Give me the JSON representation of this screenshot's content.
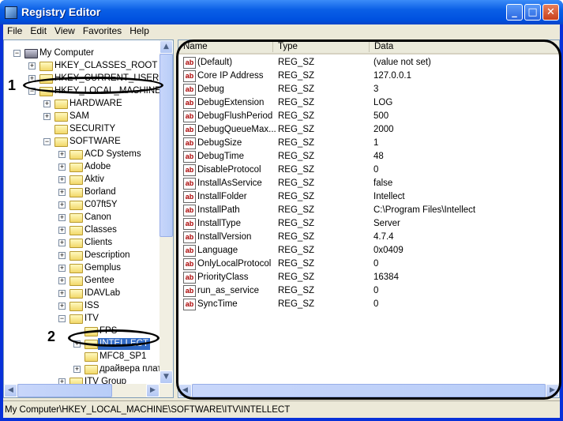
{
  "window": {
    "title": "Registry Editor",
    "min": "_",
    "max": "□",
    "close": "✕"
  },
  "menu": [
    "File",
    "Edit",
    "View",
    "Favorites",
    "Help"
  ],
  "tree": [
    {
      "label": "My Computer",
      "level": 0,
      "exp": "−",
      "icon": "computer"
    },
    {
      "label": "HKEY_CLASSES_ROOT",
      "level": 1,
      "exp": "+"
    },
    {
      "label": "HKEY_CURRENT_USER",
      "level": 1,
      "exp": "+"
    },
    {
      "label": "HKEY_LOCAL_MACHINE",
      "level": 1,
      "exp": "−"
    },
    {
      "label": "HARDWARE",
      "level": 2,
      "exp": "+"
    },
    {
      "label": "SAM",
      "level": 2,
      "exp": "+"
    },
    {
      "label": "SECURITY",
      "level": 2,
      "exp": ""
    },
    {
      "label": "SOFTWARE",
      "level": 2,
      "exp": "−"
    },
    {
      "label": "ACD Systems",
      "level": 3,
      "exp": "+"
    },
    {
      "label": "Adobe",
      "level": 3,
      "exp": "+"
    },
    {
      "label": "Aktiv",
      "level": 3,
      "exp": "+"
    },
    {
      "label": "Borland",
      "level": 3,
      "exp": "+"
    },
    {
      "label": "C07ft5Y",
      "level": 3,
      "exp": "+"
    },
    {
      "label": "Canon",
      "level": 3,
      "exp": "+"
    },
    {
      "label": "Classes",
      "level": 3,
      "exp": "+"
    },
    {
      "label": "Clients",
      "level": 3,
      "exp": "+"
    },
    {
      "label": "Description",
      "level": 3,
      "exp": "+"
    },
    {
      "label": "Gemplus",
      "level": 3,
      "exp": "+"
    },
    {
      "label": "Gentee",
      "level": 3,
      "exp": "+"
    },
    {
      "label": "IDAVLab",
      "level": 3,
      "exp": "+"
    },
    {
      "label": "ISS",
      "level": 3,
      "exp": "+"
    },
    {
      "label": "ITV",
      "level": 3,
      "exp": "−"
    },
    {
      "label": "FPS",
      "level": 4,
      "exp": ""
    },
    {
      "label": "INTELLECT",
      "level": 4,
      "exp": "+",
      "selected": true
    },
    {
      "label": "MFC8_SP1",
      "level": 4,
      "exp": ""
    },
    {
      "label": "драйвера плат",
      "level": 4,
      "exp": "+"
    },
    {
      "label": "ITV Group",
      "level": 3,
      "exp": "+"
    }
  ],
  "columns": {
    "name": "Name",
    "type": "Type",
    "data": "Data"
  },
  "values": [
    {
      "name": "(Default)",
      "type": "REG_SZ",
      "data": "(value not set)"
    },
    {
      "name": "Core IP Address",
      "type": "REG_SZ",
      "data": "127.0.0.1"
    },
    {
      "name": "Debug",
      "type": "REG_SZ",
      "data": "3"
    },
    {
      "name": "DebugExtension",
      "type": "REG_SZ",
      "data": "LOG"
    },
    {
      "name": "DebugFlushPeriod",
      "type": "REG_SZ",
      "data": "500"
    },
    {
      "name": "DebugQueueMax...",
      "type": "REG_SZ",
      "data": "2000"
    },
    {
      "name": "DebugSize",
      "type": "REG_SZ",
      "data": "1"
    },
    {
      "name": "DebugTime",
      "type": "REG_SZ",
      "data": "48"
    },
    {
      "name": "DisableProtocol",
      "type": "REG_SZ",
      "data": "0"
    },
    {
      "name": "InstallAsService",
      "type": "REG_SZ",
      "data": "false"
    },
    {
      "name": "InstallFolder",
      "type": "REG_SZ",
      "data": "Intellect"
    },
    {
      "name": "InstallPath",
      "type": "REG_SZ",
      "data": "C:\\Program Files\\Intellect"
    },
    {
      "name": "InstallType",
      "type": "REG_SZ",
      "data": "Server"
    },
    {
      "name": "InstallVersion",
      "type": "REG_SZ",
      "data": "4.7.4"
    },
    {
      "name": "Language",
      "type": "REG_SZ",
      "data": "0x0409"
    },
    {
      "name": "OnlyLocalProtocol",
      "type": "REG_SZ",
      "data": "0"
    },
    {
      "name": "PriorityClass",
      "type": "REG_SZ",
      "data": "16384"
    },
    {
      "name": "run_as_service",
      "type": "REG_SZ",
      "data": "0"
    },
    {
      "name": "SyncTime",
      "type": "REG_SZ",
      "data": "0"
    }
  ],
  "value_icon": "ab",
  "status": "My Computer\\HKEY_LOCAL_MACHINE\\SOFTWARE\\ITV\\INTELLECT",
  "annotations": {
    "one": "1",
    "two": "2"
  }
}
